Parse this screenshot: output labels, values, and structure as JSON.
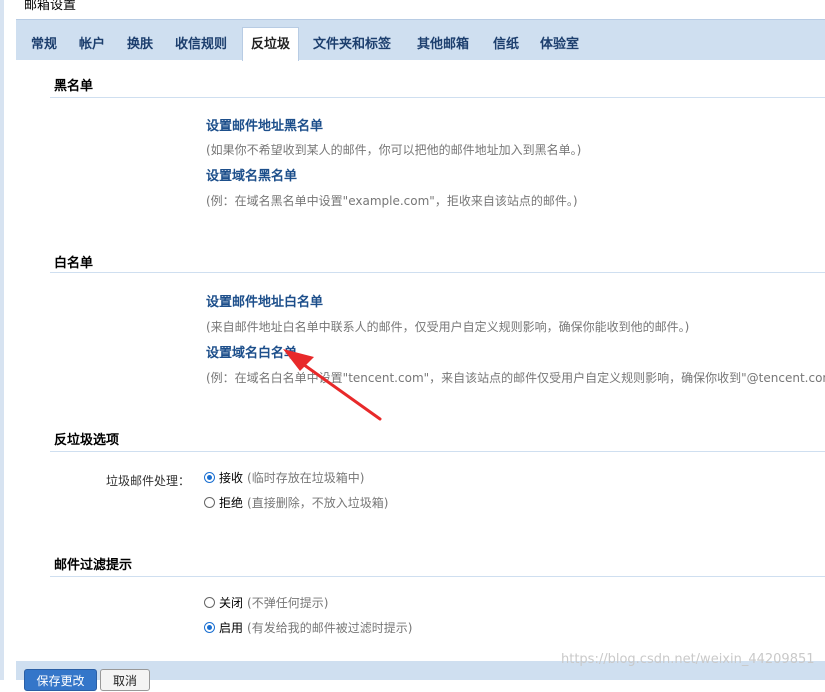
{
  "title": "邮箱设置",
  "tabs": [
    {
      "label": "常规"
    },
    {
      "label": "帐户"
    },
    {
      "label": "换肤"
    },
    {
      "label": "收信规则"
    },
    {
      "label": "反垃圾"
    },
    {
      "label": "文件夹和标签"
    },
    {
      "label": "其他邮箱"
    },
    {
      "label": "信纸"
    },
    {
      "label": "体验室"
    }
  ],
  "blacklist": {
    "heading": "黑名单",
    "address_link": "设置邮件地址黑名单",
    "address_desc": "(如果你不希望收到某人的邮件，你可以把他的邮件地址加入到黑名单。)",
    "domain_link": "设置域名黑名单",
    "domain_desc": "(例：在域名黑名单中设置\"example.com\"，拒收来自该站点的邮件。)"
  },
  "whitelist": {
    "heading": "白名单",
    "address_link": "设置邮件地址白名单",
    "address_desc": "(来自邮件地址白名单中联系人的邮件，仅受用户自定义规则影响，确保你能收到他的邮件。)",
    "domain_link": "设置域名白名单",
    "domain_desc": "(例：在域名白名单中设置\"tencent.com\"，来自该站点的邮件仅受用户自定义规则影响，确保你收到\"@tencent.con"
  },
  "antispam": {
    "heading": "反垃圾选项",
    "label": "垃圾邮件处理：",
    "options": [
      {
        "label": "接收",
        "note": "(临时存放在垃圾箱中)",
        "checked": true
      },
      {
        "label": "拒绝",
        "note": "(直接删除，不放入垃圾箱)",
        "checked": false
      }
    ]
  },
  "filter_hint": {
    "heading": "邮件过滤提示",
    "options": [
      {
        "label": "关闭",
        "note": "(不弹任何提示)",
        "checked": false
      },
      {
        "label": "启用",
        "note": "(有发给我的邮件被过滤时提示)",
        "checked": true
      }
    ]
  },
  "footer": {
    "save_label": "保存更改",
    "cancel_label": "取消"
  },
  "watermark": "https://blog.csdn.net/weixin_44209851",
  "colors": {
    "tabbar": "#cfdff0",
    "link": "#1d4f8b",
    "annotation_arrow": "#e8292a",
    "radio_checked": "#1a6fd1"
  }
}
